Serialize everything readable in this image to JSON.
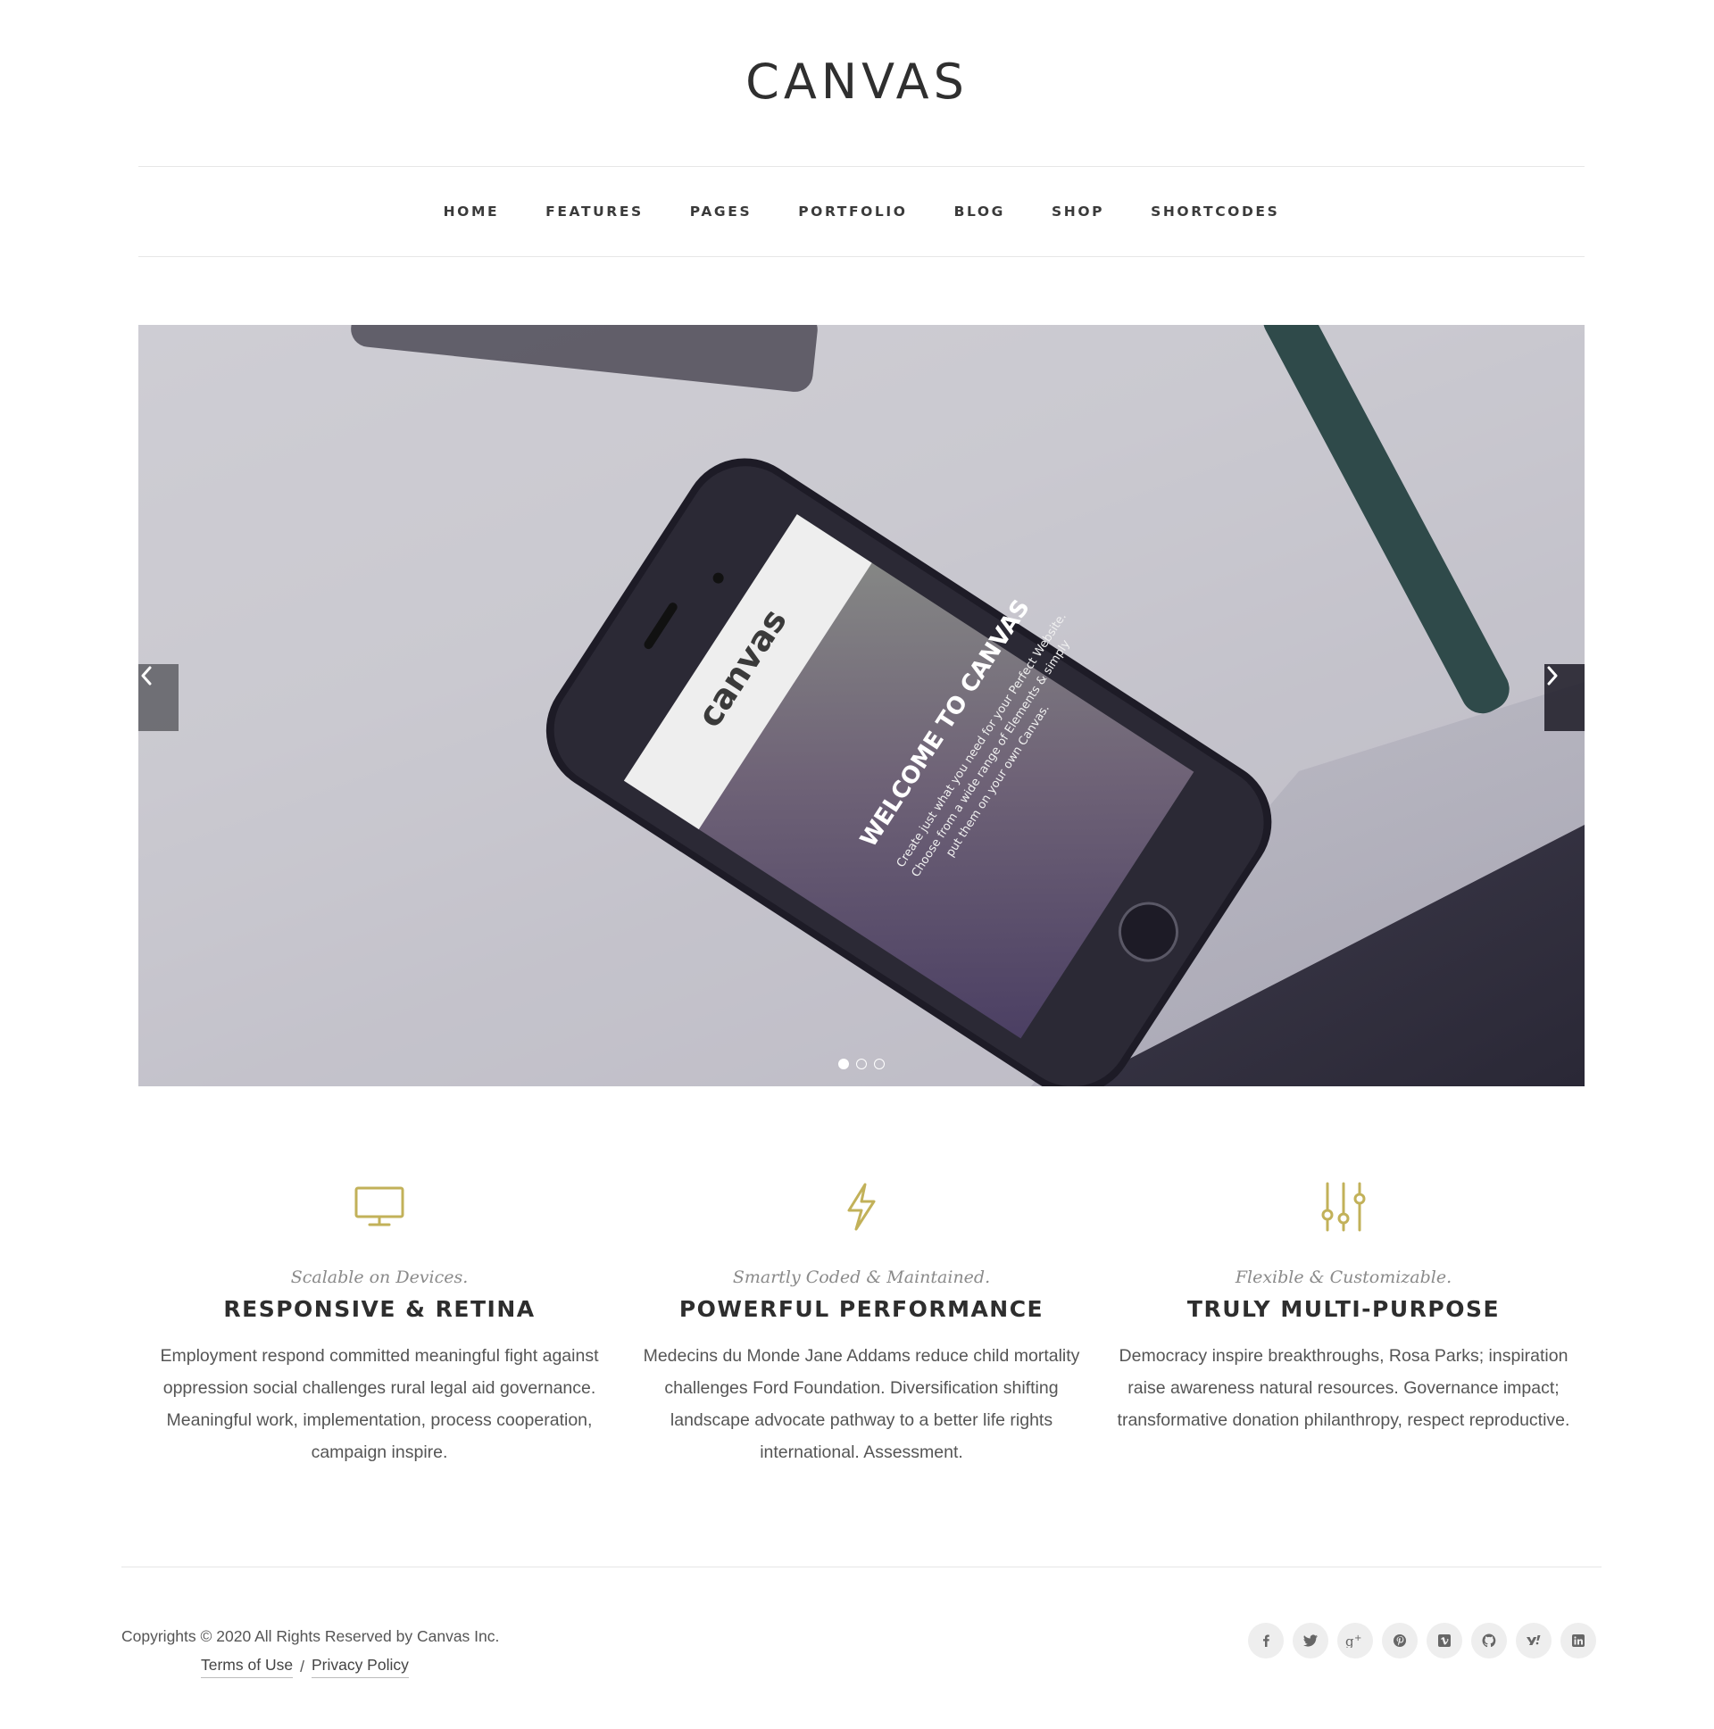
{
  "header": {
    "logo": "CANVAS"
  },
  "nav": {
    "items": [
      "HOME",
      "FEATURES",
      "PAGES",
      "PORTFOLIO",
      "BLOG",
      "SHOP",
      "SHORTCODES"
    ]
  },
  "slider": {
    "screen_brand": "canvas",
    "screen_headline": "WELCOME TO CANVAS",
    "screen_line1": "Create just what you need for your Perfect Website.",
    "screen_line2": "Choose from a wide range of Elements & simply",
    "screen_line3": "put them on your own Canvas.",
    "dots": 3,
    "active_dot": 1,
    "prev_icon": "chevron-left-icon",
    "next_icon": "chevron-right-icon"
  },
  "features": [
    {
      "icon": "monitor-icon",
      "subtitle": "Scalable on Devices.",
      "title": "RESPONSIVE & RETINA",
      "text": "Employment respond committed meaningful fight against oppression social challenges rural legal aid governance. Meaningful work, implementation, process cooperation, campaign inspire."
    },
    {
      "icon": "lightning-icon",
      "subtitle": "Smartly Coded & Maintained.",
      "title": "POWERFUL PERFORMANCE",
      "text": "Medecins du Monde Jane Addams reduce child mortality challenges Ford Foundation. Diversification shifting landscape advocate pathway to a better life rights international. Assessment."
    },
    {
      "icon": "sliders-icon",
      "subtitle": "Flexible & Customizable.",
      "title": "TRULY MULTI-PURPOSE",
      "text": "Democracy inspire breakthroughs, Rosa Parks; inspiration raise awareness natural resources. Governance impact; transformative donation philanthropy, respect reproductive."
    }
  ],
  "footer": {
    "copyright": "Copyrights © 2020 All Rights Reserved by Canvas Inc.",
    "terms": "Terms of Use",
    "separator": "/",
    "privacy": "Privacy Policy",
    "socials": [
      "facebook-icon",
      "twitter-icon",
      "google-plus-icon",
      "pinterest-icon",
      "vimeo-icon",
      "github-icon",
      "yahoo-icon",
      "linkedin-icon"
    ]
  },
  "colors": {
    "accent": "#c2b159",
    "text": "#333333"
  }
}
